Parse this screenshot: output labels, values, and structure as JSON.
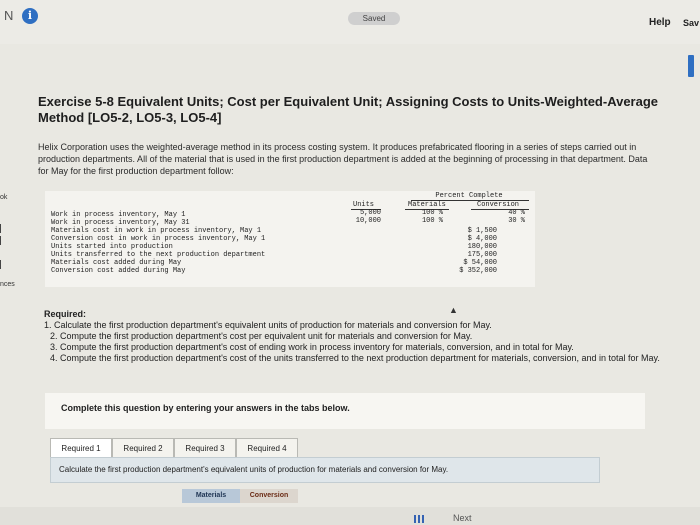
{
  "topbar": {
    "left_mark": "N",
    "info_icon": "info-icon",
    "saved_label": "Saved",
    "help_label": "Help",
    "save_label": "Sav"
  },
  "side": {
    "frag_ok": "ok",
    "frag_nces": "nces"
  },
  "exercise": {
    "title": "Exercise 5-8 Equivalent Units; Cost per Equivalent Unit; Assigning Costs to Units-Weighted-Average Method [LO5-2, LO5-3, LO5-4]",
    "intro": "Helix Corporation uses the weighted-average method in its process costing system. It produces prefabricated flooring in a series of steps carried out in production departments. All of the material that is used in the first production department is added at the beginning of processing in that department. Data for May for the first production department follow:"
  },
  "data_table": {
    "header_group": "Percent Complete",
    "col_units": "Units",
    "col_materials": "Materials",
    "col_conversion": "Conversion",
    "rows": [
      {
        "label": "Work in process inventory, May 1",
        "units": "5,000",
        "materials": "100 %",
        "conversion": "40 %",
        "amount": ""
      },
      {
        "label": "Work in process inventory, May 31",
        "units": "10,000",
        "materials": "100 %",
        "conversion": "30 %",
        "amount": ""
      },
      {
        "label": "Materials cost in work in process inventory, May 1",
        "units": "",
        "materials": "",
        "conversion": "",
        "amount": "$    1,500"
      },
      {
        "label": "Conversion cost in work in process inventory, May 1",
        "units": "",
        "materials": "",
        "conversion": "",
        "amount": "$    4,000"
      },
      {
        "label": "Units started into production",
        "units": "",
        "materials": "",
        "conversion": "",
        "amount": "180,000"
      },
      {
        "label": "Units transferred to the next production department",
        "units": "",
        "materials": "",
        "conversion": "",
        "amount": "175,000"
      },
      {
        "label": "Materials cost added during May",
        "units": "",
        "materials": "",
        "conversion": "",
        "amount": "$  54,000"
      },
      {
        "label": "Conversion cost added during May",
        "units": "",
        "materials": "",
        "conversion": "",
        "amount": "$ 352,000"
      }
    ]
  },
  "required": {
    "heading": "Required:",
    "items": [
      "1. Calculate the first production department's equivalent units of production for materials and conversion for May.",
      "2. Compute the first production department's cost per equivalent unit for materials and conversion for May.",
      "3. Compute the first production department's cost of ending work in process inventory for materials, conversion, and in total for May.",
      "4. Compute the first production department's cost of the units transferred to the next production department for materials, conversion, and in total for May."
    ]
  },
  "complete": {
    "text": "Complete this question by entering your answers in the tabs below."
  },
  "tabs": [
    {
      "label": "Required 1"
    },
    {
      "label": "Required 2"
    },
    {
      "label": "Required 3"
    },
    {
      "label": "Required 4"
    }
  ],
  "tab_panel": {
    "text": "Calculate the first production department's equivalent units of production for materials and conversion for May."
  },
  "subtabs": {
    "materials": "Materials",
    "conversion": "Conversion"
  },
  "bottom": {
    "next_fragment": "Next"
  },
  "colors": {
    "accent_blue": "#2f6fc2",
    "materials_tab": "#b8c8d8",
    "conversion_tab": "#dcd6ce"
  }
}
